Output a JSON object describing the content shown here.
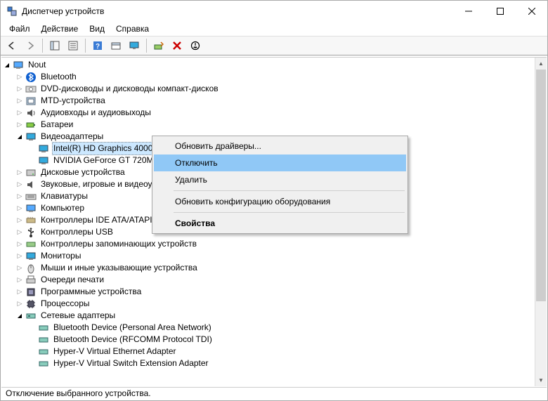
{
  "window": {
    "title": "Диспетчер устройств"
  },
  "menu": {
    "file": "Файл",
    "action": "Действие",
    "view": "Вид",
    "help": "Справка"
  },
  "tree": {
    "root": "Nout",
    "items": [
      {
        "label": "Bluetooth"
      },
      {
        "label": "DVD-дисководы и дисководы компакт-дисков"
      },
      {
        "label": "MTD-устройства"
      },
      {
        "label": "Аудиовходы и аудиовыходы"
      },
      {
        "label": "Батареи"
      },
      {
        "label": "Видеоадаптеры"
      },
      {
        "label": "Intel(R) HD Graphics 4000"
      },
      {
        "label": "NVIDIA GeForce GT 720M"
      },
      {
        "label": "Дисковые устройства"
      },
      {
        "label": "Звуковые, игровые и видеоустройства"
      },
      {
        "label": "Клавиатуры"
      },
      {
        "label": "Компьютер"
      },
      {
        "label": "Контроллеры IDE ATA/ATAPI"
      },
      {
        "label": "Контроллеры USB"
      },
      {
        "label": "Контроллеры запоминающих устройств"
      },
      {
        "label": "Мониторы"
      },
      {
        "label": "Мыши и иные указывающие устройства"
      },
      {
        "label": "Очереди печати"
      },
      {
        "label": "Программные устройства"
      },
      {
        "label": "Процессоры"
      },
      {
        "label": "Сетевые адаптеры"
      },
      {
        "label": "Bluetooth Device (Personal Area Network)"
      },
      {
        "label": "Bluetooth Device (RFCOMM Protocol TDI)"
      },
      {
        "label": "Hyper-V Virtual Ethernet Adapter"
      },
      {
        "label": "Hyper-V Virtual Switch Extension Adapter"
      }
    ]
  },
  "context_menu": {
    "update_drivers": "Обновить драйверы...",
    "disable": "Отключить",
    "delete": "Удалить",
    "scan_hw": "Обновить конфигурацию оборудования",
    "properties": "Свойства"
  },
  "status": "Отключение выбранного устройства."
}
